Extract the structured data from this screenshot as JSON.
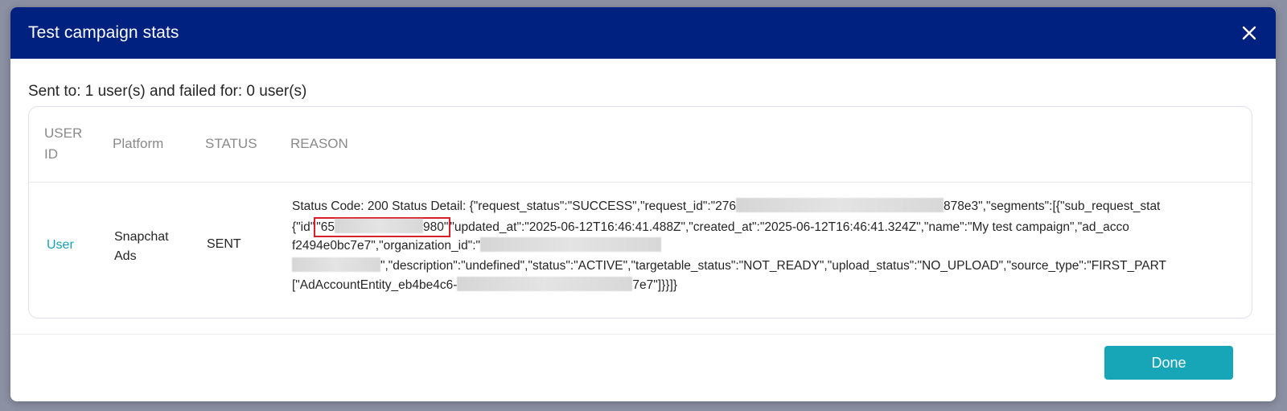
{
  "modal": {
    "title": "Test campaign stats",
    "close_icon": "close-icon"
  },
  "summary": {
    "text": "Sent to: 1 user(s) and failed for: 0 user(s)"
  },
  "table": {
    "columns": {
      "user_id": "USER ID",
      "platform": "Platform",
      "status": "STATUS",
      "reason": "REASON"
    },
    "rows": [
      {
        "user": "User",
        "platform": "Snapchat Ads",
        "status": "SENT",
        "reason_lines": [
          [
            "Status Code: 200 Status Detail: {\"request_status\":\"SUCCESS\",\"request_id\":\"276",
            "878e3\",\"segments\":[{\"sub_request_stat"
          ],
          [
            "{\"id\"",
            "\"65",
            "980\"",
            "\"updated_at\":\"2025-06-12T16:46:41.488Z\",\"created_at\":\"2025-06-12T16:46:41.324Z\",\"name\":\"My test campaign\",\"ad_acco"
          ],
          [
            "f2494e0bc7e7\",\"organization_id\":\""
          ],
          [
            "\",\"description\":\"undefined\",\"status\":\"ACTIVE\",\"targetable_status\":\"NOT_READY\",\"upload_status\":\"NO_UPLOAD\",\"source_type\":\"FIRST_PART"
          ],
          [
            "[\"AdAccountEntity_eb4be4c6-",
            "7e7\"]}}]}"
          ]
        ]
      }
    ]
  },
  "footer": {
    "done_label": "Done"
  },
  "colors": {
    "header_bg": "#00217f",
    "accent": "#17a5b8",
    "highlight": "#d8202a"
  }
}
